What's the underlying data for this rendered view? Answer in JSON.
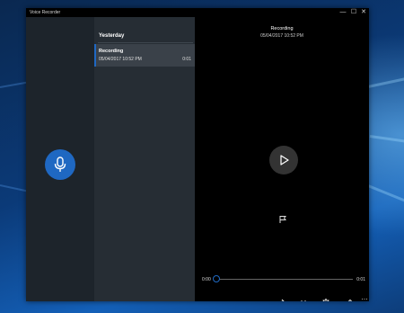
{
  "window": {
    "title": "Voice Recorder",
    "controls": {
      "minimize": "—",
      "maximize": "☐",
      "close": "✕"
    }
  },
  "record_button": {
    "icon": "microphone-icon",
    "color": "#1f68c2"
  },
  "list": {
    "group_header": "Yesterday",
    "items": [
      {
        "title": "Recording",
        "date": "05/04/2017 10:52 PM",
        "duration": "0:01",
        "selected": true
      }
    ]
  },
  "player": {
    "title": "Recording",
    "date": "05/04/2017 10:52 PM",
    "current_time": "0:00",
    "total_time": "0:01",
    "progress": 0,
    "play_icon": "play-icon",
    "marker_icon": "flag-icon",
    "toolbar": [
      "share-icon",
      "trim-icon",
      "delete-icon",
      "rename-icon",
      "more-icon"
    ],
    "more_label": "⋯"
  },
  "colors": {
    "accent": "#1f68c2",
    "left_pane": "#1d242b",
    "list_pane": "#262d34",
    "selected_item": "#3a4149"
  }
}
